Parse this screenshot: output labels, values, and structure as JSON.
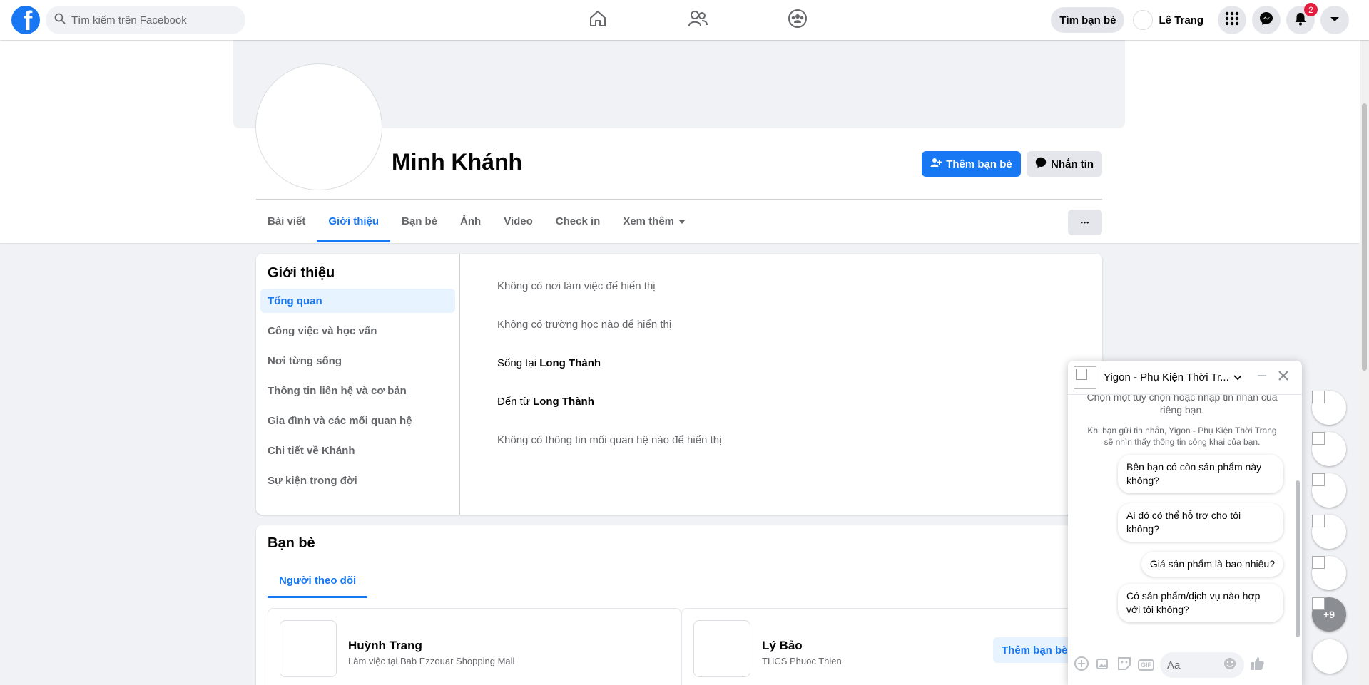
{
  "topbar": {
    "logo_letter": "f",
    "search_placeholder": "Tìm kiếm trên Facebook",
    "find_friends": "Tìm bạn bè",
    "user_name": "Lê Trang",
    "notification_count": "2"
  },
  "profile": {
    "name": "Minh Khánh",
    "add_friend": "Thêm bạn bè",
    "message": "Nhắn tin",
    "tabs": [
      "Bài viết",
      "Giới thiệu",
      "Bạn bè",
      "Ảnh",
      "Video",
      "Check in",
      "Xem thêm"
    ],
    "more_dots": "•••"
  },
  "intro": {
    "title": "Giới thiệu",
    "menu": [
      "Tổng quan",
      "Công việc và học vấn",
      "Nơi từng sống",
      "Thông tin liên hệ và cơ bản",
      "Gia đình và các mối quan hệ",
      "Chi tiết về Khánh",
      "Sự kiện trong đời"
    ],
    "rows": {
      "work": "Không có nơi làm việc để hiển thị",
      "school": "Không có trường học nào để hiển thị",
      "lives_prefix": "Sống tại ",
      "lives_place": "Long Thành",
      "from_prefix": "Đến từ ",
      "from_place": "Long Thành",
      "relationship": "Không có thông tin mối quan hệ nào để hiển thị"
    }
  },
  "friends": {
    "title": "Bạn bè",
    "tab": "Người theo dõi",
    "items": [
      {
        "name": "Huỳnh Trang",
        "sub": "Làm việc tại Bab Ezzouar Shopping Mall"
      },
      {
        "name": "Lý Bảo",
        "sub": "THCS Phuoc Thien",
        "button": "Thêm bạn bè"
      }
    ]
  },
  "chat": {
    "name": "Yigon - Phụ Kiện Thời Tr...",
    "intro_note": "Chọn một tùy chọn hoặc nhập tin nhắn của riêng bạn.",
    "privacy_note": "Khi bạn gửi tin nhắn, Yigon - Phụ Kiện Thời Trang sẽ nhìn thấy thông tin công khai của bạn.",
    "quick_replies": [
      "Bên bạn có còn sản phẩm này không?",
      "Ai đó có thể hỗ trợ cho tôi không?",
      "Giá sản phẩm là bao nhiêu?",
      "Có sản phẩm/dịch vụ nào hợp với tôi không?"
    ],
    "input_placeholder": "Aa",
    "gif_label": "GIF"
  },
  "rail": {
    "more_count": "+9"
  },
  "colors": {
    "accent": "#1877f2",
    "badge": "#e41e3f"
  }
}
